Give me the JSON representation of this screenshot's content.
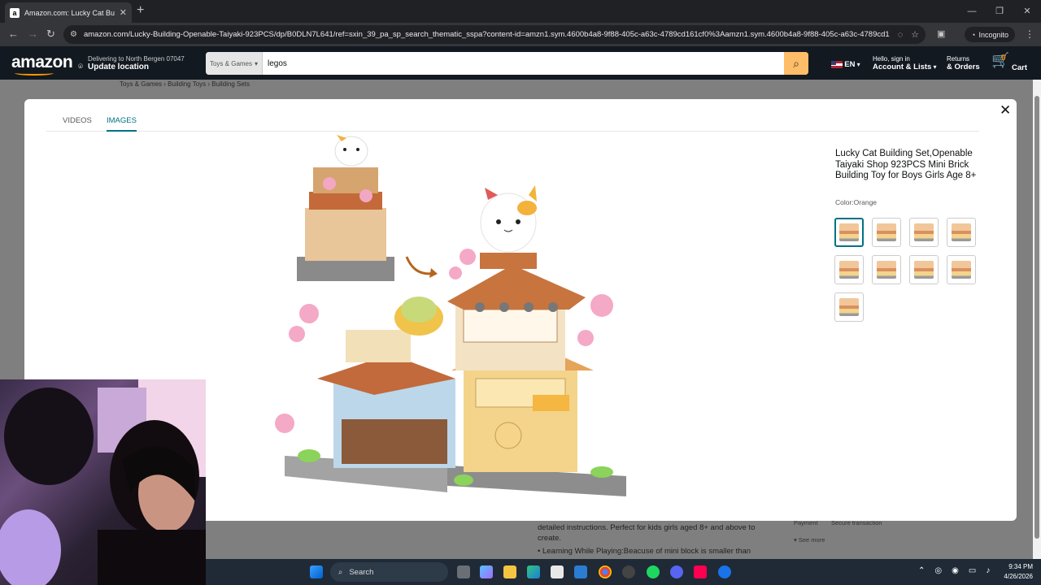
{
  "browser": {
    "tab_title": "Amazon.com: Lucky Cat Buildin",
    "tab_favicon": "a",
    "url": "amazon.com/Lucky-Building-Openable-Taiyaki-923PCS/dp/B0DLN7L641/ref=sxin_39_pa_sp_search_thematic_sspa?content-id=amzn1.sym.4600b4a8-9f88-405c-a63c-4789cd161cf0%3Aamzn1.sym.4600b4a8-9f88-405c-a63c-4789cd161cf0...",
    "incognito_label": "Incognito"
  },
  "amazon_header": {
    "logo": "amazon",
    "deliver_line1": "Delivering to North Bergen 07047",
    "deliver_line2": "Update location",
    "search_category": "Toys & Games",
    "search_query": "legos",
    "language": "EN",
    "account_line1": "Hello, sign in",
    "account_line2": "Account & Lists",
    "returns_line1": "Returns",
    "returns_line2": "& Orders",
    "cart_count": "0",
    "cart_label": "Cart"
  },
  "breadcrumb": {
    "items": [
      "Toys & Games",
      "Building Toys",
      "Building Sets"
    ],
    "separator": "›"
  },
  "modal": {
    "tabs": [
      "VIDEOS",
      "IMAGES"
    ],
    "active_tab": "IMAGES",
    "product_title": "Lucky Cat Building Set,Openable Taiyaki Shop 923PCS Mini Brick Building Toy for Boys Girls Age 8+",
    "color_label": "Color:Orange",
    "thumbnail_count": 9,
    "selected_thumbnail": 1
  },
  "background_page": {
    "text1": "detailed instructions. Perfect for kids girls aged 8+ and above to create.",
    "text2": "Learning While Playing:Beacuse of mini block is smaller than",
    "payment": "Payment",
    "secure": "Secure transaction",
    "see_more": "See more"
  },
  "taskbar": {
    "search_label": "Search",
    "time": "9:34 PM",
    "date": "4/26/2026"
  },
  "colors": {
    "amazon_dark": "#131921",
    "amazon_search_btn": "#febd69",
    "accent_teal": "#007185",
    "overlay_gray": "#7f7f7f"
  }
}
